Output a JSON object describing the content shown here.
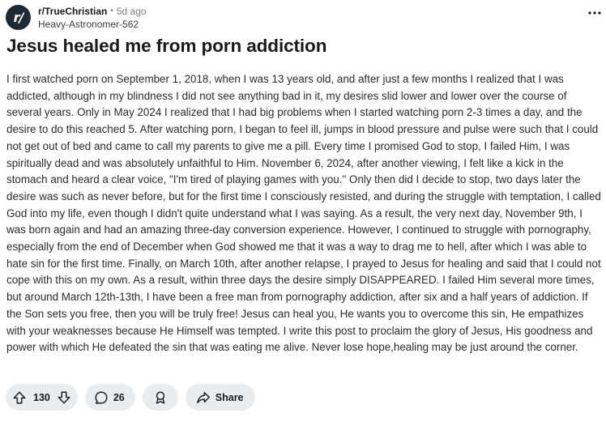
{
  "post": {
    "avatar_letter": "r/",
    "subreddit": "r/TrueChristian",
    "separator": "•",
    "age": "5d ago",
    "author": "Heavy-Astronomer-562",
    "title": "Jesus healed me from porn addiction",
    "body": "I first watched porn on September 1, 2018, when I was 13 years old, and after just a few months I realized that I was addicted, although in my blindness I did not see anything bad in it, my desires slid lower and lower over the course of several years. Only in May 2024 I realized that I had big problems when I started watching porn 2-3 times a day, and the desire to do this reached 5. After watching porn, I began to feel ill, jumps in blood pressure and pulse were such that I could not get out of bed and came to call my parents to give me a pill. Every time I promised God to stop, I failed Him, I was spiritually dead and was absolutely unfaithful to Him. November 6, 2024, after another viewing, I felt like a kick in the stomach and heard a clear voice, \"I'm tired of playing games with you.\" Only then did I decide to stop, two days later the desire was such as never before, but for the first time I consciously resisted, and during the struggle with temptation, I called God into my life, even though I didn't quite understand what I was saying. As a result, the very next day, November 9th, I was born again and had an amazing three-day conversion experience. However, I continued to struggle with pornography, especially from the end of December when God showed me that it was a way to drag me to hell, after which I was able to hate sin for the first time. Finally, on March 10th, after another relapse, I prayed to Jesus for healing and said that I could not cope with this on my own. As a result, within three days the desire simply DISAPPEARED. I failed Him several more times, but around March 12th-13th, I have been a free man from pornography addiction, after six and a half years of addiction. If the Son sets you free, then you will be truly free! Jesus can heal you, He wants you to overcome this sin, He empathizes with your weaknesses because He Himself was tempted. I write this post to proclaim the glory of Jesus, His goodness and power with which He defeated the sin that was eating me alive. Never lose hope,healing may be just around the corner."
  },
  "actions": {
    "vote_count": "130",
    "comment_count": "26",
    "share_label": "Share"
  },
  "icons": {
    "avatar": "subreddit-avatar-icon",
    "more": "more-options-icon",
    "upvote": "upvote-arrow-icon",
    "downvote": "downvote-arrow-icon",
    "comment": "comment-bubble-icon",
    "award": "award-icon",
    "share": "share-arrow-icon"
  },
  "colors": {
    "avatar_bg": "#1c2b33",
    "pill_bg": "#eaedef",
    "muted_text": "#7c7c7c"
  }
}
